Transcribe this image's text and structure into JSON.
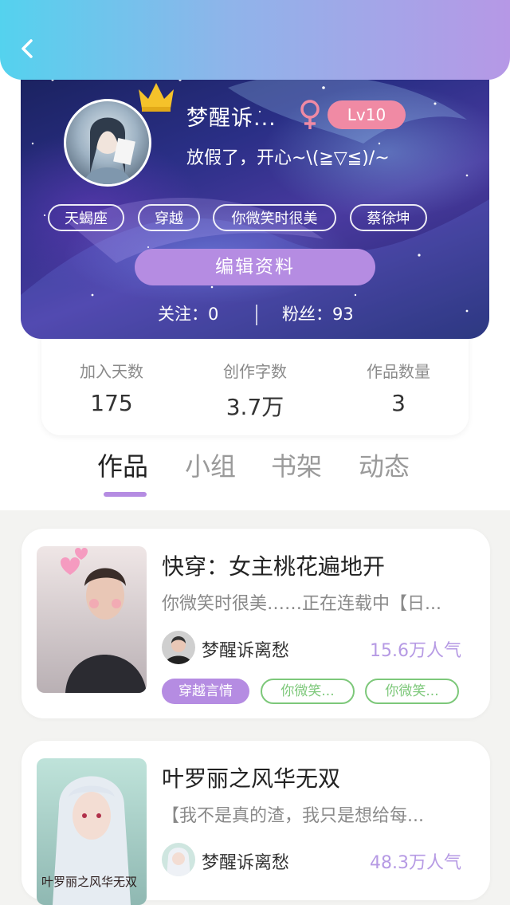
{
  "header": {
    "back_icon": "chevron-left-icon"
  },
  "profile": {
    "username": "梦醒诉...",
    "gender_icon": "female-icon",
    "level": "Lv10",
    "signature": "放假了，开心~\\(≧▽≦)/~",
    "tags": [
      "天蝎座",
      "穿越",
      "你微笑时很美",
      "蔡徐坤"
    ],
    "edit_button": "编辑资料",
    "follow_text": "关注：0",
    "fans_text": "粉丝：93"
  },
  "stats": [
    {
      "label": "加入天数",
      "value": "175"
    },
    {
      "label": "创作字数",
      "value": "3.7万"
    },
    {
      "label": "作品数量",
      "value": "3"
    }
  ],
  "tabs": [
    {
      "label": "作品",
      "active": true
    },
    {
      "label": "小组",
      "active": false
    },
    {
      "label": "书架",
      "active": false
    },
    {
      "label": "动态",
      "active": false
    }
  ],
  "works": [
    {
      "title": "快穿：女主桃花遍地开",
      "description": "你微笑时很美……正在连载中【日...",
      "author": "梦醒诉离愁",
      "popularity": "15.6万人气",
      "genre": "穿越言情",
      "keywords": [
        "你微笑...",
        "你微笑..."
      ]
    },
    {
      "title": "叶罗丽之风华无双",
      "description": "【我不是真的渣，我只是想给每...",
      "author": "梦醒诉离愁",
      "popularity": "48.3万人气",
      "cover_text": "叶罗丽之风华无双"
    }
  ],
  "colors": {
    "accent": "#b58ce2",
    "header_start": "#54d2ee",
    "header_end": "#b698e6",
    "level_badge": "#f08aa4",
    "keyword_green": "#7dc87a"
  }
}
